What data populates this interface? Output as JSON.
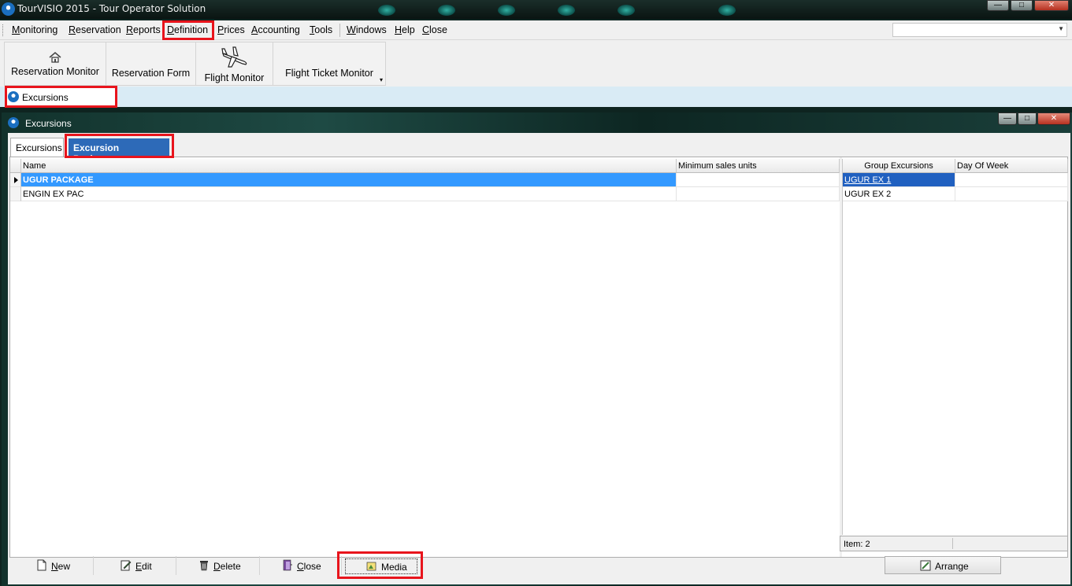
{
  "app": {
    "title": "TourVISIO 2015 - Tour Operator Solution",
    "window_buttons": [
      "—",
      "□",
      "✕"
    ]
  },
  "menu": {
    "items": [
      "Monitoring",
      "Reservation",
      "Reports",
      "Definition",
      "Prices",
      "Accounting",
      "Tools",
      "Windows",
      "Help",
      "Close"
    ],
    "combo_value": ""
  },
  "toolbar": {
    "buttons": [
      "Reservation Monitor",
      "Reservation Form",
      "Flight Monitor",
      "Flight Ticket Monitor"
    ]
  },
  "mdi_tab": {
    "label": "Excursions"
  },
  "child_window": {
    "title": "Excursions",
    "tabs": [
      "Excursions",
      "Excursion Packages"
    ]
  },
  "packages_grid": {
    "columns": [
      "Name",
      "Minimum sales units"
    ],
    "rows": [
      {
        "name": "UGUR PACKAGE",
        "min_units": ""
      },
      {
        "name": "ENGIN EX PAC",
        "min_units": ""
      }
    ]
  },
  "group_grid": {
    "columns": [
      "Group Excursions",
      "Day Of Week"
    ],
    "rows": [
      {
        "group": "UGUR EX 1",
        "day": ""
      },
      {
        "group": "UGUR EX 2",
        "day": ""
      }
    ],
    "status": "Item: 2"
  },
  "actions": {
    "new": "New",
    "edit": "Edit",
    "delete": "Delete",
    "close": "Close",
    "media": "Media",
    "arrange": "Arrange"
  },
  "colors": {
    "highlight": "#e8141c",
    "selection": "#3399ff",
    "tab_active": "#2d6ab8",
    "mdi_strip": "#d9ebf5"
  }
}
